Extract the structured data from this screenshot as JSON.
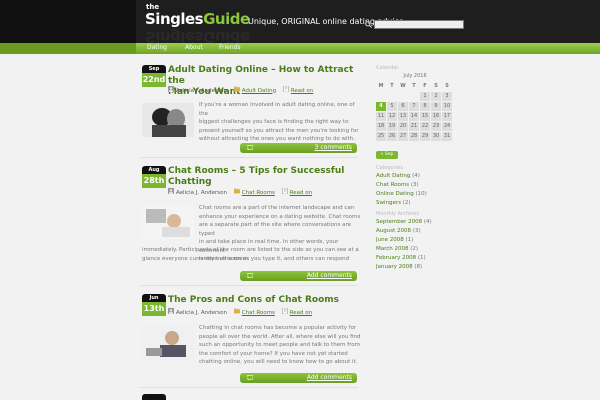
{
  "header": {
    "logo_the": "the",
    "logo_singles": "Singles",
    "logo_guide": "Guide",
    "tagline": "Unique, ORIGINAL online dating advice",
    "search_placeholder": ""
  },
  "nav": {
    "items": [
      {
        "label": "Dating"
      },
      {
        "label": "About"
      },
      {
        "label": "Friends"
      }
    ]
  },
  "posts": [
    {
      "month": "Sep",
      "day": "22nd",
      "title_line1": "Adult Dating Online – How to Attract the",
      "title_line2": "Man You Want",
      "author": "Aelicia J. Anderson",
      "category": "Adult Dating",
      "read_on": "Read on",
      "excerpt": [
        "If you're a woman involved in adult dating online, one of the",
        "biggest challenges you face is finding the right way to",
        "present yourself so you attract the men you're looking for",
        "without attracting the ones you want nothing to do with."
      ],
      "comments": "3 comments"
    },
    {
      "month": "Aug",
      "day": "28th",
      "title_line1": "Chat Rooms – 5 Tips for Successful",
      "title_line2": "Chatting",
      "author": "Aelicia J. Anderson",
      "category": "Chat Rooms",
      "read_on": "Read on",
      "excerpt": [
        "Chat rooms are a part of the internet landscape and can",
        "enhance your experience on a dating website. Chat rooms",
        "are a separate part of the site where conversations are typed",
        "in and take place in real time. In other words, your comment",
        "is seen as soon as you type it, and others can respond",
        "immediately. Participants of the room are listed to the side so you can see at a",
        "glance everyone currently in the room."
      ],
      "comments": "Add comments"
    },
    {
      "month": "Jun",
      "day": "13th",
      "title_line1": "The Pros and Cons of Chat Rooms",
      "title_line2": "",
      "author": "Aelicia J. Anderson",
      "category": "Chat Rooms",
      "read_on": "Read on",
      "excerpt": [
        "Chatting in chat rooms has become a popular activity for",
        "people all over the world. After all, where else will you find",
        "such an opportunity to meet people and talk to them from",
        "the comfort of your home? If you have not yet started",
        "chatting online, you will need to know how to go about it."
      ],
      "comments": "Add comments"
    }
  ],
  "sidebar": {
    "calendar_heading": "Calendar",
    "calendar_caption": "July 2016",
    "weekdays": [
      "M",
      "T",
      "W",
      "T",
      "F",
      "S",
      "S"
    ],
    "weeks": [
      [
        "",
        "",
        "",
        "",
        "1",
        "2",
        "3"
      ],
      [
        "4",
        "5",
        "6",
        "7",
        "8",
        "9",
        "10"
      ],
      [
        "11",
        "12",
        "13",
        "14",
        "15",
        "16",
        "17"
      ],
      [
        "18",
        "19",
        "20",
        "21",
        "22",
        "23",
        "24"
      ],
      [
        "25",
        "26",
        "27",
        "28",
        "29",
        "30",
        "31"
      ]
    ],
    "today": "4",
    "prev_label": "« Sep",
    "categories_heading": "Categories",
    "categories": [
      {
        "name": "Adult Dating",
        "count": "(4)"
      },
      {
        "name": "Chat Rooms",
        "count": "(3)"
      },
      {
        "name": "Online Dating",
        "count": "(10)"
      },
      {
        "name": "Swingers",
        "count": "(2)"
      }
    ],
    "archives_heading": "Monthly Archives",
    "archives": [
      {
        "name": "September 2008",
        "count": "(4)"
      },
      {
        "name": "August 2008",
        "count": "(3)"
      },
      {
        "name": "June 2008",
        "count": "(1)"
      },
      {
        "name": "March 2008",
        "count": "(2)"
      },
      {
        "name": "February 2008",
        "count": "(1)"
      },
      {
        "name": "January 2008",
        "count": "(8)"
      }
    ]
  },
  "colors": {
    "accent_green": "#7cb82f",
    "title_green": "#4b7d16",
    "header_black": "#111111"
  }
}
